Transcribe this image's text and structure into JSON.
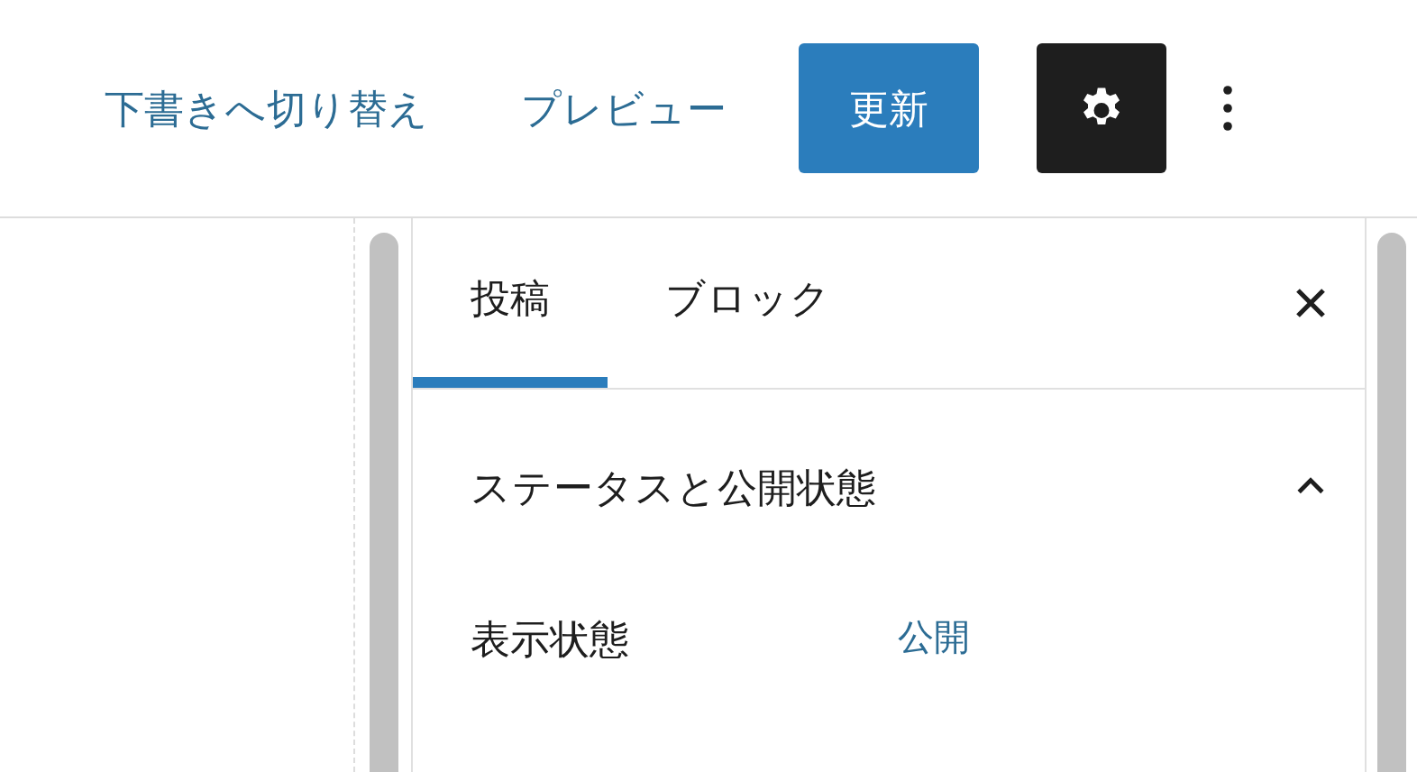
{
  "header": {
    "draft_link": "下書きへ切り替え",
    "preview_link": "プレビュー",
    "update_button": "更新",
    "settings_active": true
  },
  "sidebar": {
    "tabs": [
      {
        "label": "投稿",
        "selected": true
      },
      {
        "label": "ブロック",
        "selected": false
      }
    ],
    "section": {
      "title": "ステータスと公開状態",
      "expanded": true,
      "rows": [
        {
          "label": "表示状態",
          "value": "公開"
        }
      ]
    }
  }
}
